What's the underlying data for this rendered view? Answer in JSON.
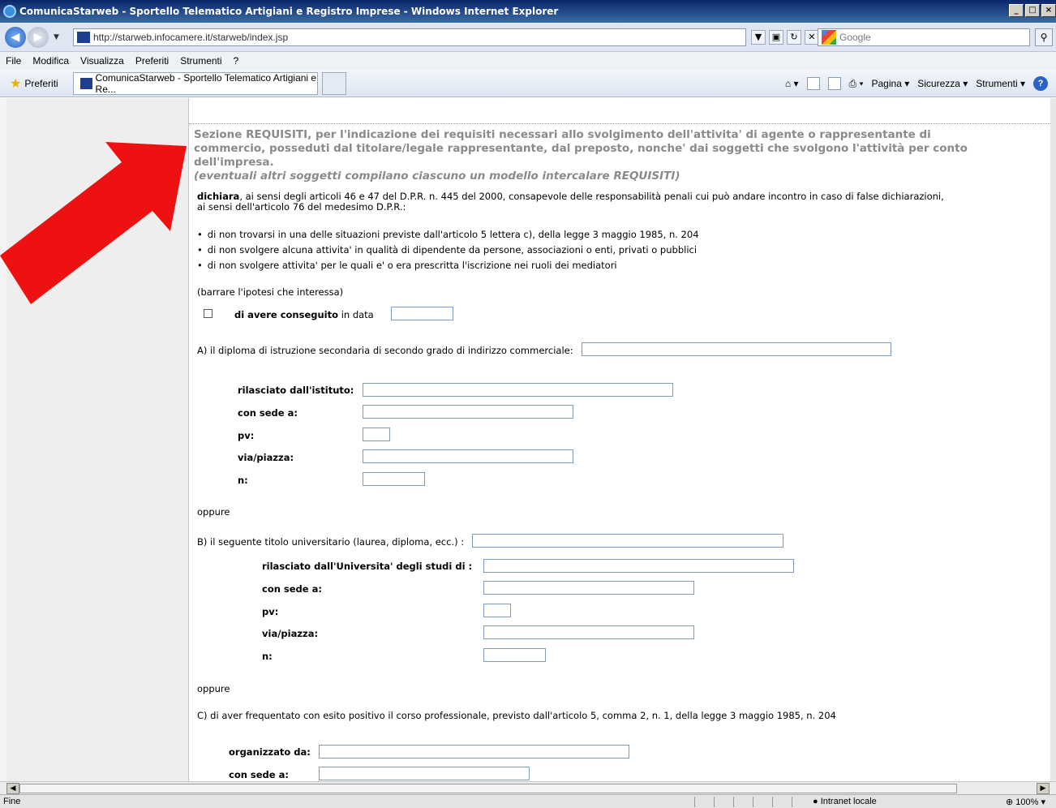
{
  "window": {
    "title": "ComunicaStarweb - Sportello Telematico Artigiani e Registro Imprese - Windows Internet Explorer",
    "controls": [
      "_",
      "□",
      "×"
    ]
  },
  "address_bar": {
    "url": "http://starweb.infocamere.it/starweb/index.jsp"
  },
  "search": {
    "placeholder": "Google"
  },
  "menu": [
    "File",
    "Modifica",
    "Visualizza",
    "Preferiti",
    "Strumenti",
    "?"
  ],
  "favorites_bar": {
    "favorites_label": "Preferiti",
    "tab_title": "ComunicaStarweb - Sportello Telematico Artigiani e Re...",
    "commands": [
      "Pagina",
      "Sicurezza",
      "Strumenti"
    ]
  },
  "page": {
    "heading": "Sezione REQUISITI, per l'indicazione dei requisiti necessari allo svolgimento dell'attivita' di agente o rappresentante di commercio, posseduti dal titolare/legale rappresentante, dal preposto, nonche' dai soggetti che svolgono l'attività per conto dell'impresa.",
    "heading_italic": "(eventuali altri soggetti compilano ciascuno un modello intercalare REQUISITI)",
    "dichiara_bold": "dichiara",
    "dichiara_text": ", ai sensi degli articoli 46 e 47 del D.P.R. n. 445 del 2000, consapevole delle responsabilità penali cui può andare incontro in caso di false dichiarazioni,",
    "dichiara_text2": "ai sensi dell'articolo 76 del medesimo D.P.R.:",
    "bullets": [
      "di non trovarsi in una delle situazioni previste dall'articolo 5 lettera c), della legge 3 maggio 1985, n. 204",
      "di non svolgere alcuna attivita' in qualità di dipendente da persone, associazioni o enti, privati o pubblici",
      "di non svolgere attivita' per le quali e' o era prescritta l'iscrizione nei ruoli dei mediatori"
    ],
    "barrare": "(barrare l'ipotesi che interessa)",
    "conseguito_bold": "di avere conseguito",
    "conseguito_text": "in data",
    "section_a": "A) il diploma di istruzione secondaria di secondo grado di indirizzo commerciale:",
    "a_fields": [
      "rilasciato dall'istituto:",
      "con sede a:",
      "pv:",
      "via/piazza:",
      "n:"
    ],
    "oppure": "oppure",
    "section_b": "B) il seguente titolo universitario (laurea, diploma, ecc.) :",
    "b_fields": [
      "rilasciato dall'Universita' degli studi di :",
      "con sede a:",
      "pv:",
      "via/piazza:",
      "n:"
    ],
    "section_c": "C) di aver frequentato con esito positivo il corso professionale, previsto dall'articolo 5, comma 2, n. 1, della legge 3 maggio 1985, n. 204",
    "c_fields": [
      "organizzato da:",
      "con sede a:"
    ]
  },
  "status_bar": {
    "status": "Fine",
    "zone": "Intranet locale",
    "zoom": "100%"
  },
  "colors": {
    "arrow": "#ee1111",
    "heading": "#8a8a8a",
    "titlebar": "#0a246a"
  }
}
